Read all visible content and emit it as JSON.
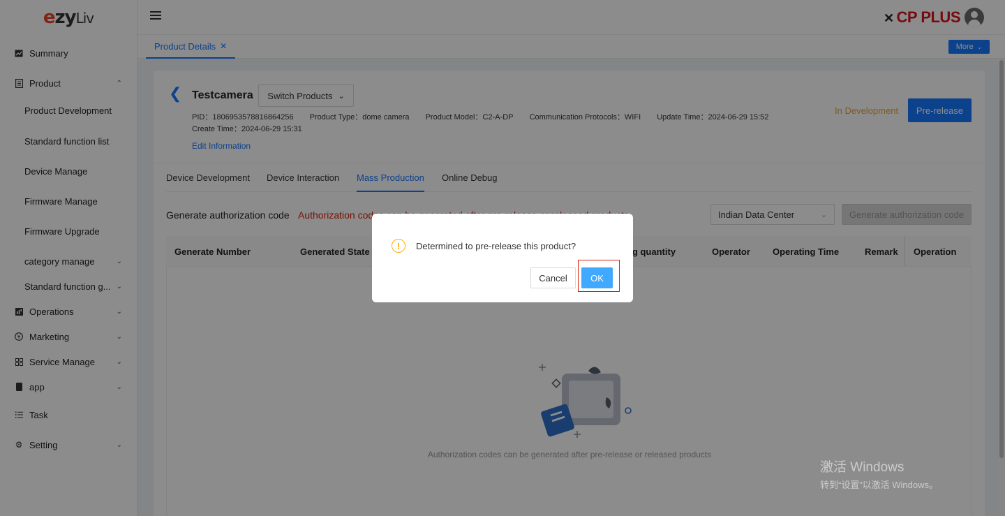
{
  "sidebar": {
    "logo": {
      "part1": "e",
      "part2": "zy",
      "part3": "Liv"
    },
    "items": [
      {
        "label": "Summary",
        "icon": "chart-icon"
      },
      {
        "label": "Product",
        "icon": "document-icon"
      },
      {
        "label": "Operations",
        "icon": "operations-icon"
      },
      {
        "label": "Marketing",
        "icon": "yen-icon"
      },
      {
        "label": "Service Manage",
        "icon": "grid-icon"
      },
      {
        "label": "app",
        "icon": "phone-icon"
      },
      {
        "label": "Task",
        "icon": "list-icon"
      },
      {
        "label": "Setting",
        "icon": "gear-icon"
      }
    ],
    "product_sub": [
      "Product Development",
      "Standard function list",
      "Device Manage",
      "Firmware Manage",
      "Firmware Upgrade",
      "category manage",
      "Standard function g..."
    ]
  },
  "header": {
    "brand": "CP PLUS",
    "page_tab": "Product Details",
    "page_tab_close": "✕",
    "more": "More"
  },
  "product": {
    "name": "Testcamera",
    "switch_label": "Switch Products",
    "pid": "PID：1806953578816864256",
    "type": "Product Type：dome camera",
    "model": "Product Model：C2-A-DP",
    "protocols": "Communication Protocols：WIFI",
    "update_time": "Update Time：2024-06-29 15:52",
    "create_time": "Create Time：2024-06-29 15:31",
    "edit_link": "Edit Information",
    "status": "In Development",
    "prerelease_label": "Pre-release"
  },
  "tabs": [
    "Device Development",
    "Device Interaction",
    "Mass Production",
    "Online Debug"
  ],
  "auth": {
    "label": "Generate authorization code",
    "warning": "Authorization codes can be generated after pre-release or released products",
    "data_center": "Indian Data Center",
    "generate_button": "Generate authorization code"
  },
  "table": {
    "headers": [
      "Generate Number",
      "Generated State",
      "ng quantity",
      "Operator",
      "Operating Time",
      "Remark",
      "Operation"
    ],
    "empty_text": "Authorization codes can be generated after pre-release or released products"
  },
  "modal": {
    "message": "Determined to pre-release this product?",
    "cancel": "Cancel",
    "ok": "OK"
  },
  "watermark": {
    "line1": "激活 Windows",
    "line2": "转到“设置”以激活 Windows。"
  },
  "colors": {
    "accent": "#1677ff",
    "warning": "#e8a33b",
    "error": "#d81e06",
    "brand_red": "#d7141c"
  }
}
